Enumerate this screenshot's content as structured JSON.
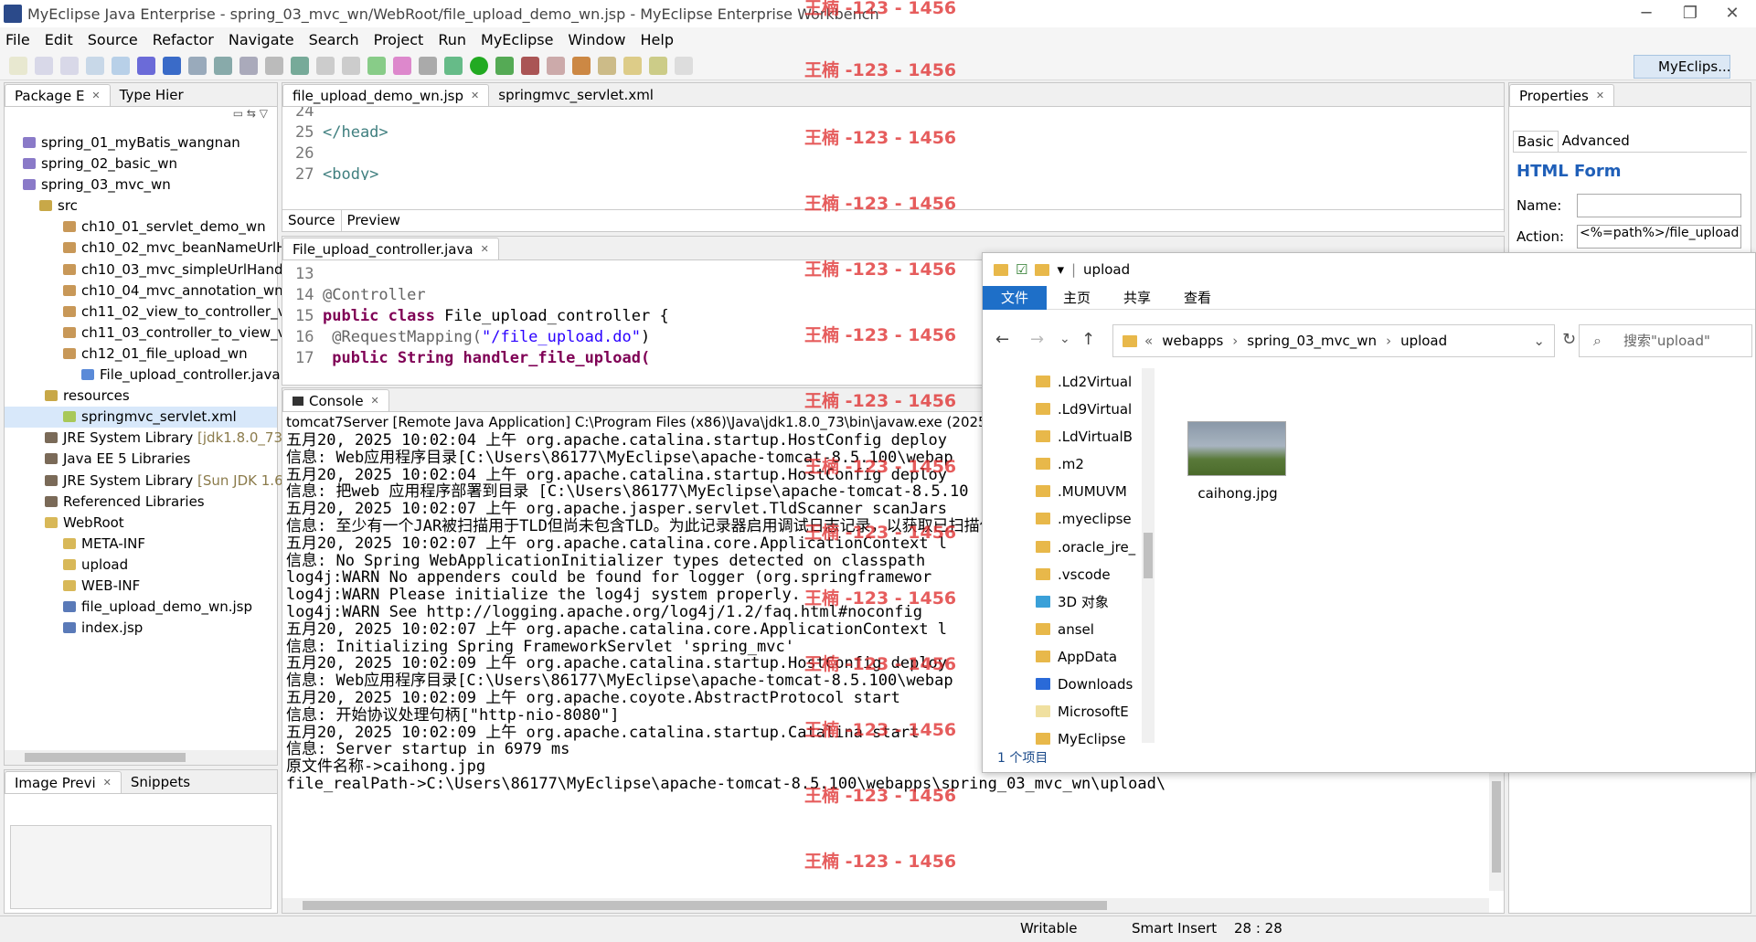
{
  "window": {
    "title": "MyEclipse Java Enterprise - spring_03_mvc_wn/WebRoot/file_upload_demo_wn.jsp - MyEclipse Enterprise Workbench"
  },
  "menu": [
    "File",
    "Edit",
    "Source",
    "Refactor",
    "Navigate",
    "Search",
    "Project",
    "Run",
    "MyEclipse",
    "Window",
    "Help"
  ],
  "perspective": "MyEclips...",
  "watermark": "王楠 -123 - 1456",
  "package_explorer": {
    "tabs": [
      "Package E",
      "Type Hier"
    ],
    "items": [
      {
        "label": "spring_01_myBatis_wangnan"
      },
      {
        "label": "spring_02_basic_wn"
      },
      {
        "label": "spring_03_mvc_wn"
      },
      {
        "label": "src"
      },
      {
        "label": "ch10_01_servlet_demo_wn"
      },
      {
        "label": "ch10_02_mvc_beanNameUrlH"
      },
      {
        "label": "ch10_03_mvc_simpleUrlHandl"
      },
      {
        "label": "ch10_04_mvc_annotation_wn"
      },
      {
        "label": "ch11_02_view_to_controller_v"
      },
      {
        "label": "ch11_03_controller_to_view_v"
      },
      {
        "label": "ch12_01_file_upload_wn"
      },
      {
        "label": "File_upload_controller.java"
      },
      {
        "label": "resources"
      },
      {
        "label": "springmvc_servlet.xml"
      },
      {
        "label": "JRE System Library",
        "suffix": "[jdk1.8.0_73]"
      },
      {
        "label": "Java EE 5 Libraries"
      },
      {
        "label": "JRE System Library",
        "suffix": "[Sun JDK 1.6."
      },
      {
        "label": "Referenced Libraries"
      },
      {
        "label": "WebRoot"
      },
      {
        "label": "META-INF"
      },
      {
        "label": "upload"
      },
      {
        "label": "WEB-INF"
      },
      {
        "label": "file_upload_demo_wn.jsp"
      },
      {
        "label": "index.jsp"
      }
    ]
  },
  "image_preview": {
    "tabs": [
      "Image Previ",
      "Snippets"
    ]
  },
  "editor_top": {
    "tabs": [
      "file_upload_demo_wn.jsp",
      "springmvc_servlet.xml"
    ],
    "lines": [
      {
        "n": "24",
        "text": ""
      },
      {
        "n": "25",
        "text": "</head>"
      },
      {
        "n": "26",
        "text": ""
      },
      {
        "n": "27",
        "text": "<body>"
      }
    ],
    "bottom_tabs": [
      "Source",
      "Preview"
    ]
  },
  "editor_java": {
    "tab": "File_upload_controller.java",
    "lines": [
      {
        "n": "13",
        "text": ""
      },
      {
        "n": "14",
        "text": "@Controller"
      },
      {
        "n": "15a",
        "text": "public class"
      },
      {
        "n": "15b",
        "text": " File_upload_controller {"
      },
      {
        "n": "16a",
        "text": "    @RequestMapping("
      },
      {
        "n": "16b",
        "text": "\"/file_upload.do\""
      },
      {
        "n": "16c",
        "text": ")"
      },
      {
        "n": "17",
        "text": "    public String handler_file_upload("
      }
    ],
    "line_numbers": [
      "13",
      "14",
      "15",
      "16",
      "17"
    ]
  },
  "console": {
    "tab": "Console",
    "header": "tomcat7Server [Remote Java Application] C:\\Program Files (x86)\\Java\\jdk1.8.0_73\\bin\\javaw.exe (2025-5-",
    "lines": [
      "五月20, 2025 10:02:04 上午 org.apache.catalina.startup.HostConfig deploy",
      "信息: Web应用程序目录[C:\\Users\\86177\\MyEclipse\\apache-tomcat-8.5.100\\webap",
      "五月20, 2025 10:02:04 上午 org.apache.catalina.startup.HostConfig deploy",
      "信息: 把web 应用程序部署到目录 [C:\\Users\\86177\\MyEclipse\\apache-tomcat-8.5.10",
      "五月20, 2025 10:02:07 上午 org.apache.jasper.servlet.TldScanner scanJars",
      "信息: 至少有一个JAR被扫描用于TLD但尚未包含TLD。为此记录器启用调试日志记录，以获取已扫描但未在其中",
      "五月20, 2025 10:02:07 上午 org.apache.catalina.core.ApplicationContext l",
      "信息: No Spring WebApplicationInitializer types detected on classpath",
      "log4j:WARN No appenders could be found for logger (org.springframewor",
      "log4j:WARN Please initialize the log4j system properly.",
      "log4j:WARN See http://logging.apache.org/log4j/1.2/faq.html#noconfig",
      "五月20, 2025 10:02:07 上午 org.apache.catalina.core.ApplicationContext l",
      "信息: Initializing Spring FrameworkServlet 'spring_mvc'",
      "五月20, 2025 10:02:09 上午 org.apache.catalina.startup.HostConfig deploy",
      "信息: Web应用程序目录[C:\\Users\\86177\\MyEclipse\\apache-tomcat-8.5.100\\webap",
      "五月20, 2025 10:02:09 上午 org.apache.coyote.AbstractProtocol start",
      "信息: 开始协议处理句柄[\"http-nio-8080\"]",
      "五月20, 2025 10:02:09 上午 org.apache.catalina.startup.Catalina start",
      "信息: Server startup in 6979 ms",
      "原文件名称->caihong.jpg",
      "file_realPath->C:\\Users\\86177\\MyEclipse\\apache-tomcat-8.5.100\\webapps\\spring_03_mvc_wn\\upload\\"
    ]
  },
  "properties": {
    "tab": "Properties",
    "subtabs": [
      "Basic",
      "Advanced"
    ],
    "heading": "HTML Form",
    "name_label": "Name:",
    "action_label": "Action:",
    "action_value": "<%=path%>/file_upload"
  },
  "explorer": {
    "title": "upload",
    "ribbon": [
      "文件",
      "主页",
      "共享",
      "查看"
    ],
    "breadcrumb": [
      "«",
      "webapps",
      "spring_03_mvc_wn",
      "upload"
    ],
    "search_placeholder": "搜索\"upload\"",
    "nav_items": [
      ".Ld2Virtual",
      ".Ld9Virtual",
      ".LdVirtualB",
      ".m2",
      ".MUMUVM",
      ".myeclipse",
      ".oracle_jre_",
      ".vscode",
      "3D 对象",
      "ansel",
      "AppData",
      "Downloads",
      "MicrosoftE",
      "MyEclipse"
    ],
    "file": "caihong.jpg",
    "status": "1 个项目"
  },
  "statusbar": {
    "writable": "Writable",
    "mode": "Smart Insert",
    "position": "28 : 28"
  }
}
